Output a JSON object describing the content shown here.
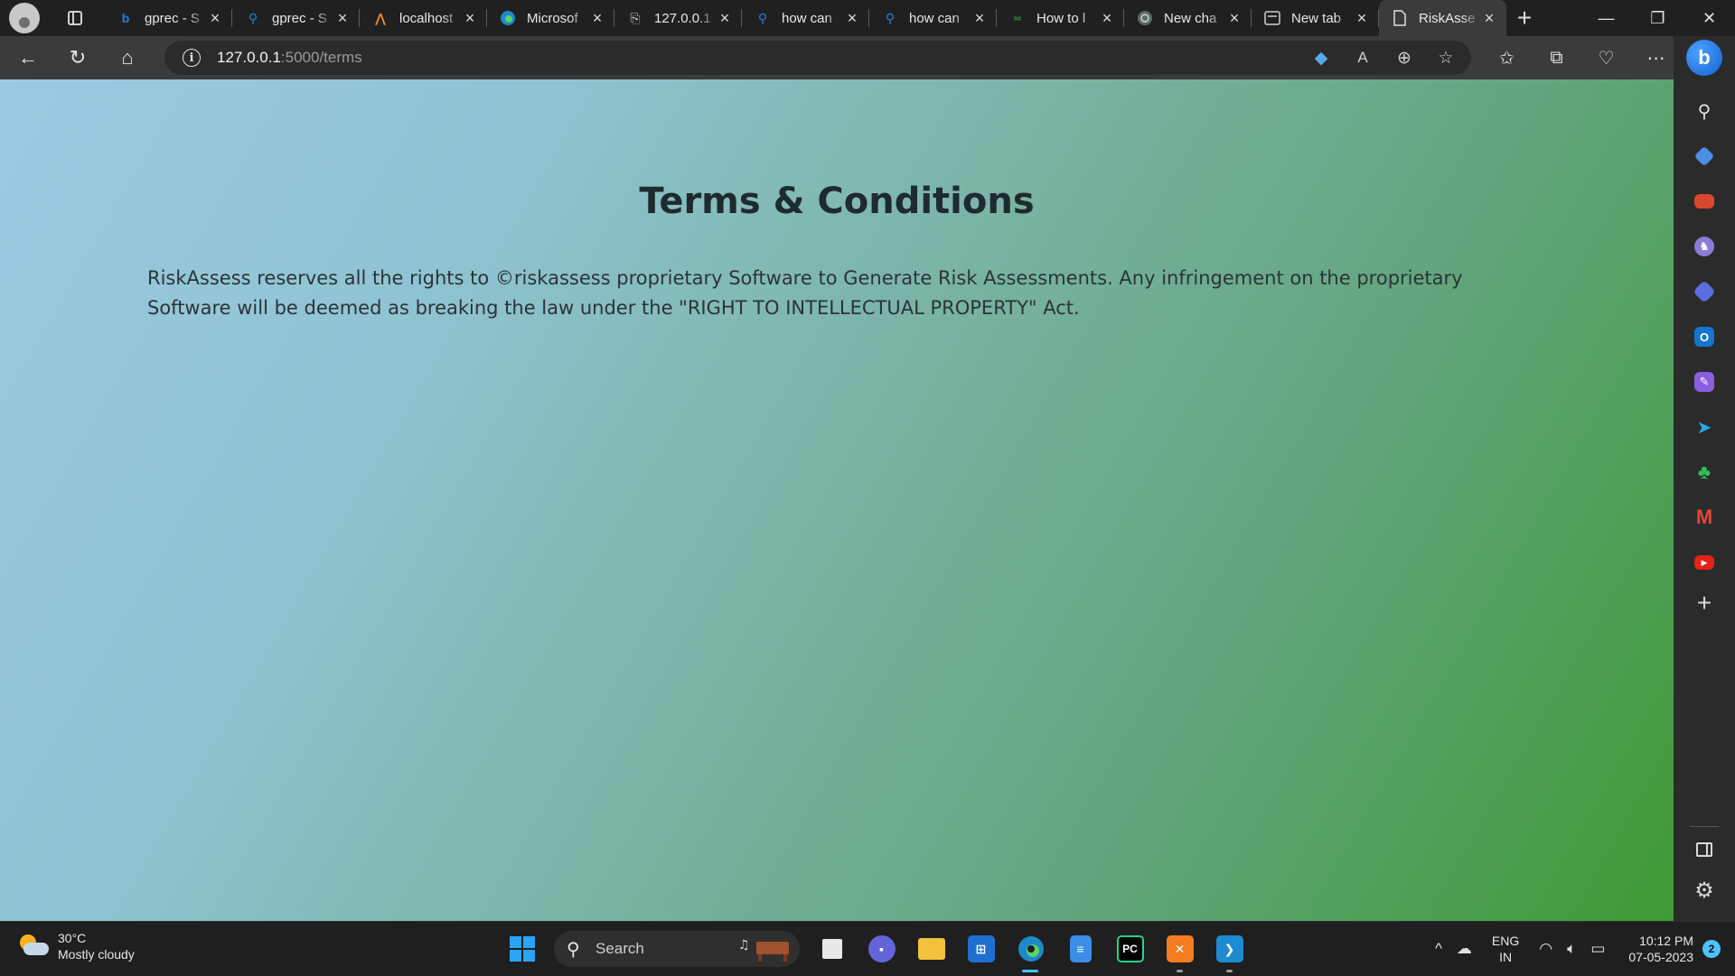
{
  "browser": {
    "tabs": [
      {
        "label": "gprec - S",
        "icon": "bing-icon",
        "active": false
      },
      {
        "label": "gprec - S",
        "icon": "search-icon",
        "active": false
      },
      {
        "label": "localhost",
        "icon": "xampp-icon",
        "active": false
      },
      {
        "label": "Microsof",
        "icon": "edge-icon",
        "active": false
      },
      {
        "label": "127.0.0.1",
        "icon": "page-error-icon",
        "active": false
      },
      {
        "label": "how can",
        "icon": "search-icon",
        "active": false
      },
      {
        "label": "how can",
        "icon": "search-icon",
        "active": false
      },
      {
        "label": "How to l",
        "icon": "geeks-icon",
        "active": false
      },
      {
        "label": "New cha",
        "icon": "chatgpt-icon",
        "active": false
      },
      {
        "label": "New tab",
        "icon": "newtab-icon",
        "active": false
      },
      {
        "label": "RiskAsse",
        "icon": "page-icon",
        "active": true
      }
    ],
    "address": {
      "host": "127.0.0.1",
      "path": ":5000/terms"
    }
  },
  "page": {
    "title": "Terms & Conditions",
    "body": "RiskAssess reserves all the rights to ©riskassess proprietary Software to Generate Risk Assessments. Any infringement on the proprietary Software will be deemed as breaking the law under the \"RIGHT TO INTELLECTUAL PROPERTY\" Act."
  },
  "taskbar": {
    "weather": {
      "temp": "30°C",
      "condition": "Mostly cloudy"
    },
    "search_label": "Search",
    "lang": {
      "line1": "ENG",
      "line2": "IN"
    },
    "clock": {
      "time": "10:12 PM",
      "date": "07-05-2023"
    },
    "notifications": "2"
  }
}
